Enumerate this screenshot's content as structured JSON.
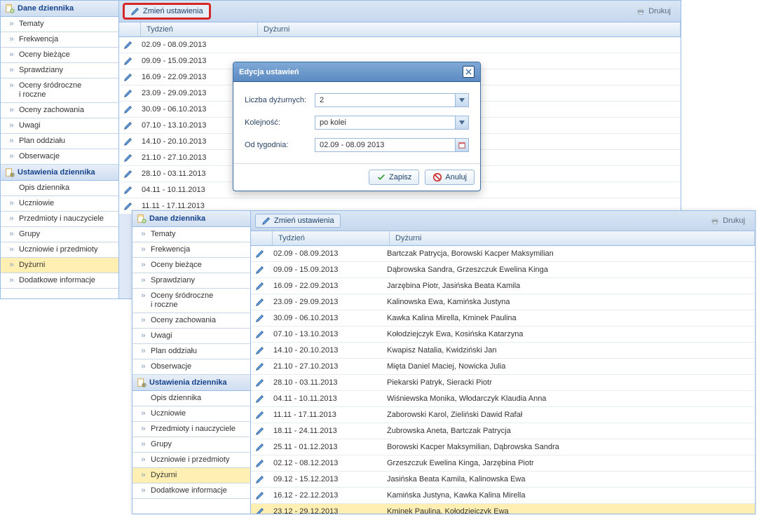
{
  "section1_title": "Dane dziennika",
  "section2_title": "Ustawienia dziennika",
  "nav1": [
    "Tematy",
    "Frekwencja",
    "Oceny bieżące",
    "Sprawdziany",
    "Oceny śródroczne\ni roczne",
    "Oceny zachowania",
    "Uwagi",
    "Plan oddziału",
    "Obserwacje"
  ],
  "nav2": [
    "Opis dziennika",
    "Uczniowie",
    "Przedmioty i nauczyciele",
    "Grupy",
    "Uczniowie i przedmioty",
    "Dyżurni",
    "Dodatkowe informacje"
  ],
  "toolbar": {
    "change": "Zmień ustawienia",
    "print": "Drukuj"
  },
  "cols": {
    "tydz": "Tydzień",
    "dyz": "Dyżurni"
  },
  "rows1": [
    "02.09 - 08.09.2013",
    "09.09 - 15.09.2013",
    "16.09 - 22.09.2013",
    "23.09 - 29.09.2013",
    "30.09 - 06.10.2013",
    "07.10 - 13.10.2013",
    "14.10 - 20.10.2013",
    "21.10 - 27.10.2013",
    "28.10 - 03.11.2013",
    "04.11 - 10.11.2013",
    "11.11 - 17.11.2013"
  ],
  "rows2": [
    {
      "t": "02.09 - 08.09.2013",
      "d": "Bartczak Patrycja, Borowski Kacper Maksymilian"
    },
    {
      "t": "09.09 - 15.09.2013",
      "d": "Dąbrowska Sandra, Grzeszczuk Ewelina Kinga"
    },
    {
      "t": "16.09 - 22.09.2013",
      "d": "Jarzębina Piotr, Jasińska Beata Kamila"
    },
    {
      "t": "23.09 - 29.09.2013",
      "d": "Kalinowska Ewa, Kamińska Justyna"
    },
    {
      "t": "30.09 - 06.10.2013",
      "d": "Kawka Kalina Mirella, Kminek Paulina"
    },
    {
      "t": "07.10 - 13.10.2013",
      "d": "Kołodziejczyk Ewa, Kosińska Katarzyna"
    },
    {
      "t": "14.10 - 20.10.2013",
      "d": "Kwapisz Natalia, Kwidziński Jan"
    },
    {
      "t": "21.10 - 27.10.2013",
      "d": "Mięta Daniel Maciej, Nowicka Julia"
    },
    {
      "t": "28.10 - 03.11.2013",
      "d": "Piekarski Patryk, Sieracki Piotr"
    },
    {
      "t": "04.11 - 10.11.2013",
      "d": "Wiśniewska Monika, Włodarczyk Klaudia Anna"
    },
    {
      "t": "11.11 - 17.11.2013",
      "d": "Zaborowski Karol, Zieliński Dawid Rafał"
    },
    {
      "t": "18.11 - 24.11.2013",
      "d": "Żubrowska Aneta, Bartczak Patrycja"
    },
    {
      "t": "25.11 - 01.12.2013",
      "d": "Borowski Kacper Maksymilian, Dąbrowska Sandra"
    },
    {
      "t": "02.12 - 08.12.2013",
      "d": "Grzeszczuk Ewelina Kinga, Jarzębina Piotr"
    },
    {
      "t": "09.12 - 15.12.2013",
      "d": "Jasińska Beata Kamila, Kalinowska Ewa"
    },
    {
      "t": "16.12 - 22.12.2013",
      "d": "Kamińska Justyna, Kawka Kalina Mirella"
    },
    {
      "t": "23.12 - 29.12.2013",
      "d": "Kminek Paulina, Kołodziejczyk Ewa"
    }
  ],
  "dialog": {
    "title": "Edycja ustawień",
    "liczba_label": "Liczba dyżurnych:",
    "kolej_label": "Kolejność:",
    "od_label": "Od tygodnia:",
    "liczba_val": "2",
    "kolej_val": "po kolei",
    "od_val": "02.09 - 08.09 2013",
    "save": "Zapisz",
    "cancel": "Anuluj"
  }
}
